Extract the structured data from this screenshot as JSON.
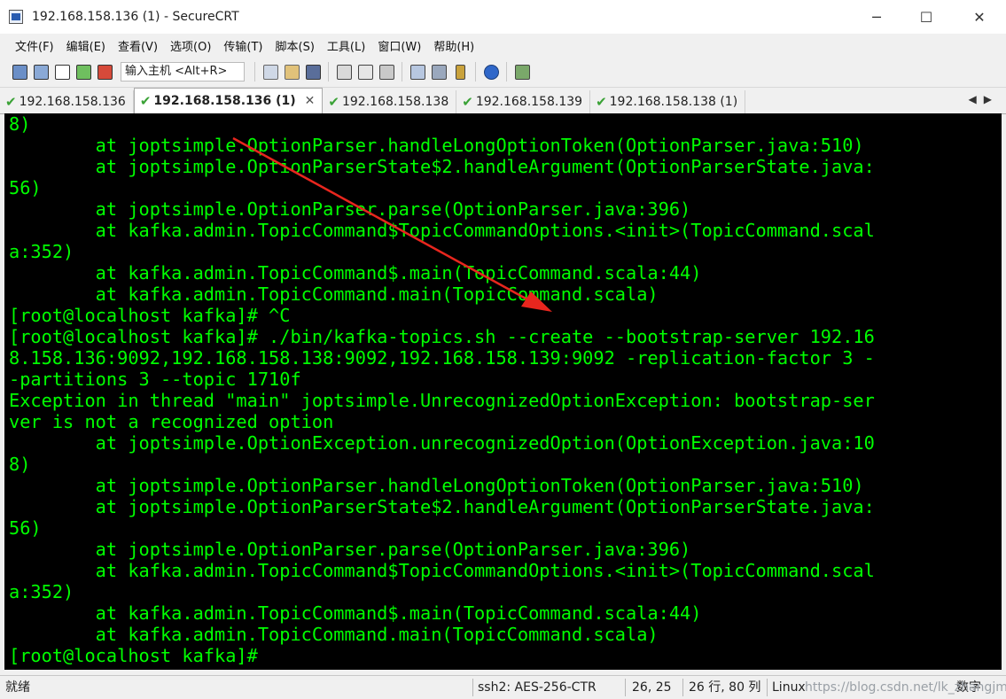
{
  "window": {
    "title": "192.168.158.136 (1) - SecureCRT",
    "controls": {
      "minimize": "─",
      "maximize": "☐",
      "close": "✕"
    }
  },
  "menu": [
    "文件(F)",
    "编辑(E)",
    "查看(V)",
    "选项(O)",
    "传输(T)",
    "脚本(S)",
    "工具(L)",
    "窗口(W)",
    "帮助(H)"
  ],
  "toolbar": {
    "quick_connect_placeholder": "输入主机 <Alt+R>"
  },
  "tabs": [
    {
      "label": "192.168.158.136",
      "active": false
    },
    {
      "label": "192.168.158.136 (1)",
      "active": true,
      "close": "✕"
    },
    {
      "label": "192.168.158.138",
      "active": false
    },
    {
      "label": "192.168.158.139",
      "active": false
    },
    {
      "label": "192.168.158.138 (1)",
      "active": false
    }
  ],
  "tab_nav": {
    "prev": "◀",
    "next": "▶"
  },
  "terminal": {
    "lines": [
      "8)",
      "        at joptsimple.OptionParser.handleLongOptionToken(OptionParser.java:510)",
      "        at joptsimple.OptionParserState$2.handleArgument(OptionParserState.java:",
      "56)",
      "        at joptsimple.OptionParser.parse(OptionParser.java:396)",
      "        at kafka.admin.TopicCommand$TopicCommandOptions.<init>(TopicCommand.scal",
      "a:352)",
      "        at kafka.admin.TopicCommand$.main(TopicCommand.scala:44)",
      "        at kafka.admin.TopicCommand.main(TopicCommand.scala)",
      "[root@localhost kafka]# ^C",
      "[root@localhost kafka]# ./bin/kafka-topics.sh --create --bootstrap-server 192.16",
      "8.158.136:9092,192.168.158.138:9092,192.168.158.139:9092 -replication-factor 3 -",
      "-partitions 3 --topic 1710f",
      "Exception in thread \"main\" joptsimple.UnrecognizedOptionException: bootstrap-ser",
      "ver is not a recognized option",
      "        at joptsimple.OptionException.unrecognizedOption(OptionException.java:10",
      "8)",
      "        at joptsimple.OptionParser.handleLongOptionToken(OptionParser.java:510)",
      "        at joptsimple.OptionParserState$2.handleArgument(OptionParserState.java:",
      "56)",
      "        at joptsimple.OptionParser.parse(OptionParser.java:396)",
      "        at kafka.admin.TopicCommand$TopicCommandOptions.<init>(TopicCommand.scal",
      "a:352)",
      "        at kafka.admin.TopicCommand$.main(TopicCommand.scala:44)",
      "        at kafka.admin.TopicCommand.main(TopicCommand.scala)",
      "[root@localhost kafka]#"
    ]
  },
  "status": {
    "ready": "就绪",
    "protocol": "ssh2: AES-256-CTR",
    "cursor": "26,  25",
    "size": "26 行, 80 列",
    "os": "Linux",
    "numlock": "数字",
    "watermark": "https://blog.csdn.net/lk_zhangjm"
  },
  "colors": {
    "terminal_fg": "#00ff00",
    "terminal_bg": "#000000",
    "annotation_arrow": "#e8261e"
  }
}
